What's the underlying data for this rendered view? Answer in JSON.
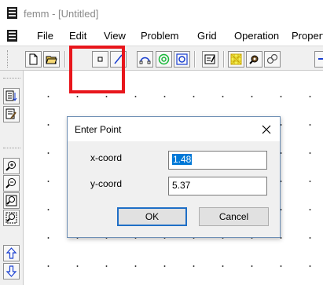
{
  "window": {
    "title": "femm - [Untitled]"
  },
  "menu": {
    "items": [
      "File",
      "Edit",
      "View",
      "Problem",
      "Grid",
      "Operation",
      "Properties"
    ]
  },
  "toolbar": {
    "buttons": [
      "new-file-icon",
      "open-folder-icon",
      "point-mode-icon",
      "segment-mode-icon",
      "arc-mode-icon",
      "block-label-icon",
      "group-icon",
      "properties-icon",
      "mesh-icon",
      "gear-icon",
      "analyze-icon",
      "view-results-icon"
    ]
  },
  "left_toolbar": {
    "buttons": [
      "zoom-in-icon",
      "zoom-out-icon",
      "zoom-natural-icon",
      "zoom-window-icon",
      "pan-up-icon",
      "pan-down-icon"
    ]
  },
  "dialog": {
    "title": "Enter Point",
    "x_label": "x-coord",
    "x_value": "1.48",
    "y_label": "y-coord",
    "y_value": "5.37",
    "ok_label": "OK",
    "cancel_label": "Cancel"
  },
  "colors": {
    "highlight": "#e8161c",
    "selection": "#0078d7"
  }
}
